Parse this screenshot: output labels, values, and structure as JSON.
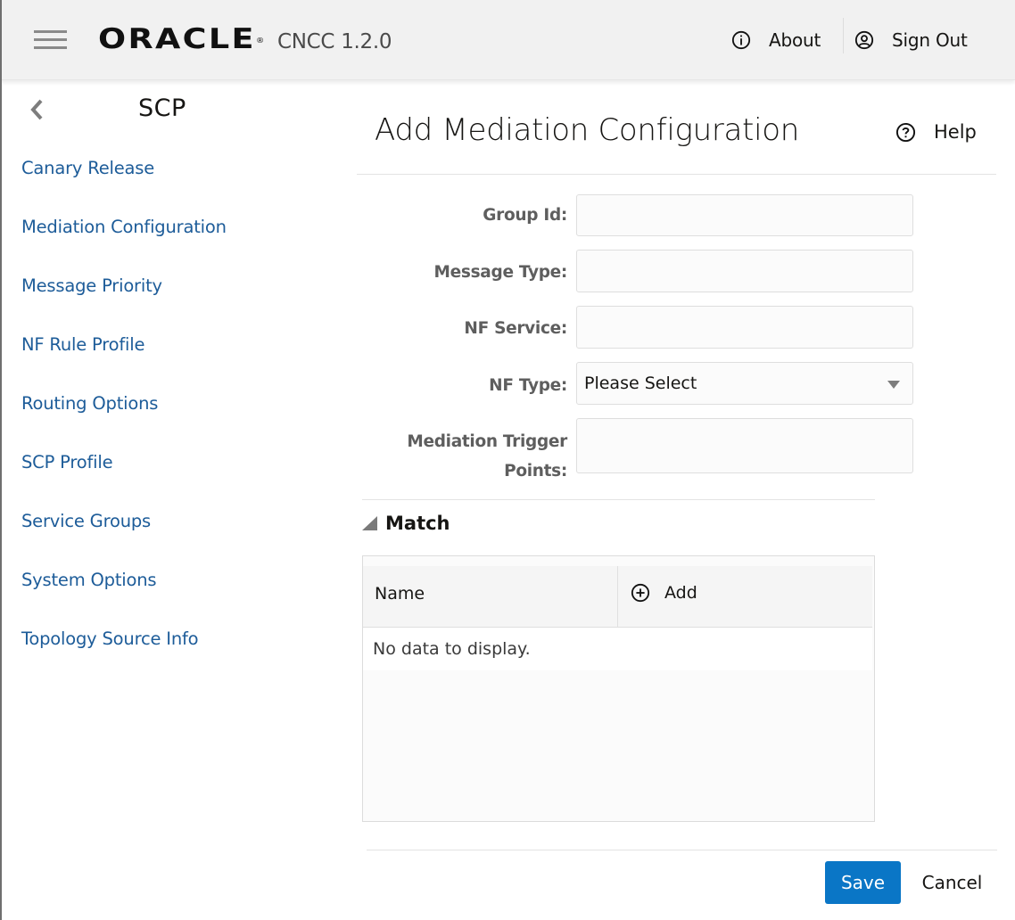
{
  "header": {
    "brand": "ORACLE",
    "brand_mark": "®",
    "app_version": "CNCC 1.2.0",
    "about_label": "About",
    "signout_label": "Sign Out",
    "icons": {
      "menu": "hamburger-icon",
      "about": "info-circle-icon",
      "signout": "user-circle-icon"
    }
  },
  "sidebar": {
    "title": "SCP",
    "back_icon": "chevron-left-icon",
    "items": [
      {
        "label": "Canary Release"
      },
      {
        "label": "Mediation Configuration"
      },
      {
        "label": "Message Priority"
      },
      {
        "label": "NF Rule Profile"
      },
      {
        "label": "Routing Options"
      },
      {
        "label": "SCP Profile"
      },
      {
        "label": "Service Groups"
      },
      {
        "label": "System Options"
      },
      {
        "label": "Topology Source Info"
      }
    ]
  },
  "main": {
    "title": "Add Mediation Configuration",
    "help_label": "Help",
    "form": {
      "group_id": {
        "label": "Group Id:",
        "value": ""
      },
      "message_type": {
        "label": "Message Type:",
        "value": ""
      },
      "nf_service": {
        "label": "NF Service:",
        "value": ""
      },
      "nf_type": {
        "label": "NF Type:",
        "selected": "Please Select"
      },
      "mediation_trigger_points": {
        "label_line1": "Mediation Trigger",
        "label_line2": "Points:",
        "value": ""
      }
    },
    "match_section": {
      "title": "Match",
      "expanded": true,
      "columns": [
        "Name",
        "Add"
      ],
      "empty_message": "No data to display.",
      "rows": []
    },
    "actions": {
      "save_label": "Save",
      "cancel_label": "Cancel"
    }
  },
  "colors": {
    "accent": "#0a76c6",
    "nav_link": "#1d5c99",
    "header_bg": "#f1f1f1"
  }
}
